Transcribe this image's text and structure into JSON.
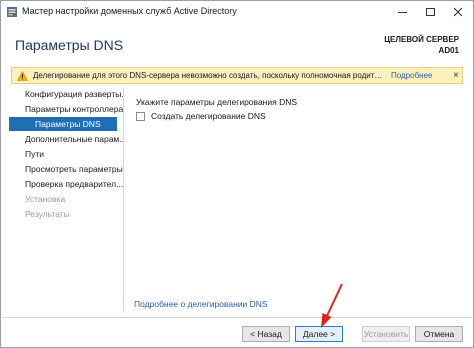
{
  "window": {
    "title": "Мастер настройки доменных служб Active Directory"
  },
  "header": {
    "page_title": "Параметры DNS",
    "server_caption": "ЦЕЛЕВОЙ СЕРВЕР",
    "server_name": "AD01"
  },
  "warning": {
    "text": "Делегирование для этого DNS-сервера невозможно создать, поскольку полномочная родительск...",
    "link": "Подробнее",
    "close": "×"
  },
  "nav": {
    "items": [
      {
        "label": "Конфигурация разверты...",
        "state": "normal"
      },
      {
        "label": "Параметры контроллера...",
        "state": "normal"
      },
      {
        "label": "Параметры DNS",
        "state": "active"
      },
      {
        "label": "Дополнительные парам...",
        "state": "normal"
      },
      {
        "label": "Пути",
        "state": "normal"
      },
      {
        "label": "Просмотреть параметры",
        "state": "normal"
      },
      {
        "label": "Проверка предварител...",
        "state": "normal"
      },
      {
        "label": "Установка",
        "state": "disabled"
      },
      {
        "label": "Результаты",
        "state": "disabled"
      }
    ]
  },
  "content": {
    "heading": "Укажите параметры делегирования DNS",
    "checkbox_label": "Создать делегирование DNS",
    "checkbox_checked": false,
    "more_link": "Подробнее о делегировании DNS"
  },
  "footer": {
    "back": "< Назад",
    "next": "Далее >",
    "install": "Установить",
    "cancel": "Отмена"
  },
  "colors": {
    "accent": "#1e6fb3",
    "title_blue": "#1d3a66",
    "warning_bg": "#fdf0bf",
    "link": "#2a5db0",
    "arrow": "#e0241b"
  },
  "icons": {
    "app": "server-manager-icon",
    "warning": "warning-triangle-icon"
  }
}
